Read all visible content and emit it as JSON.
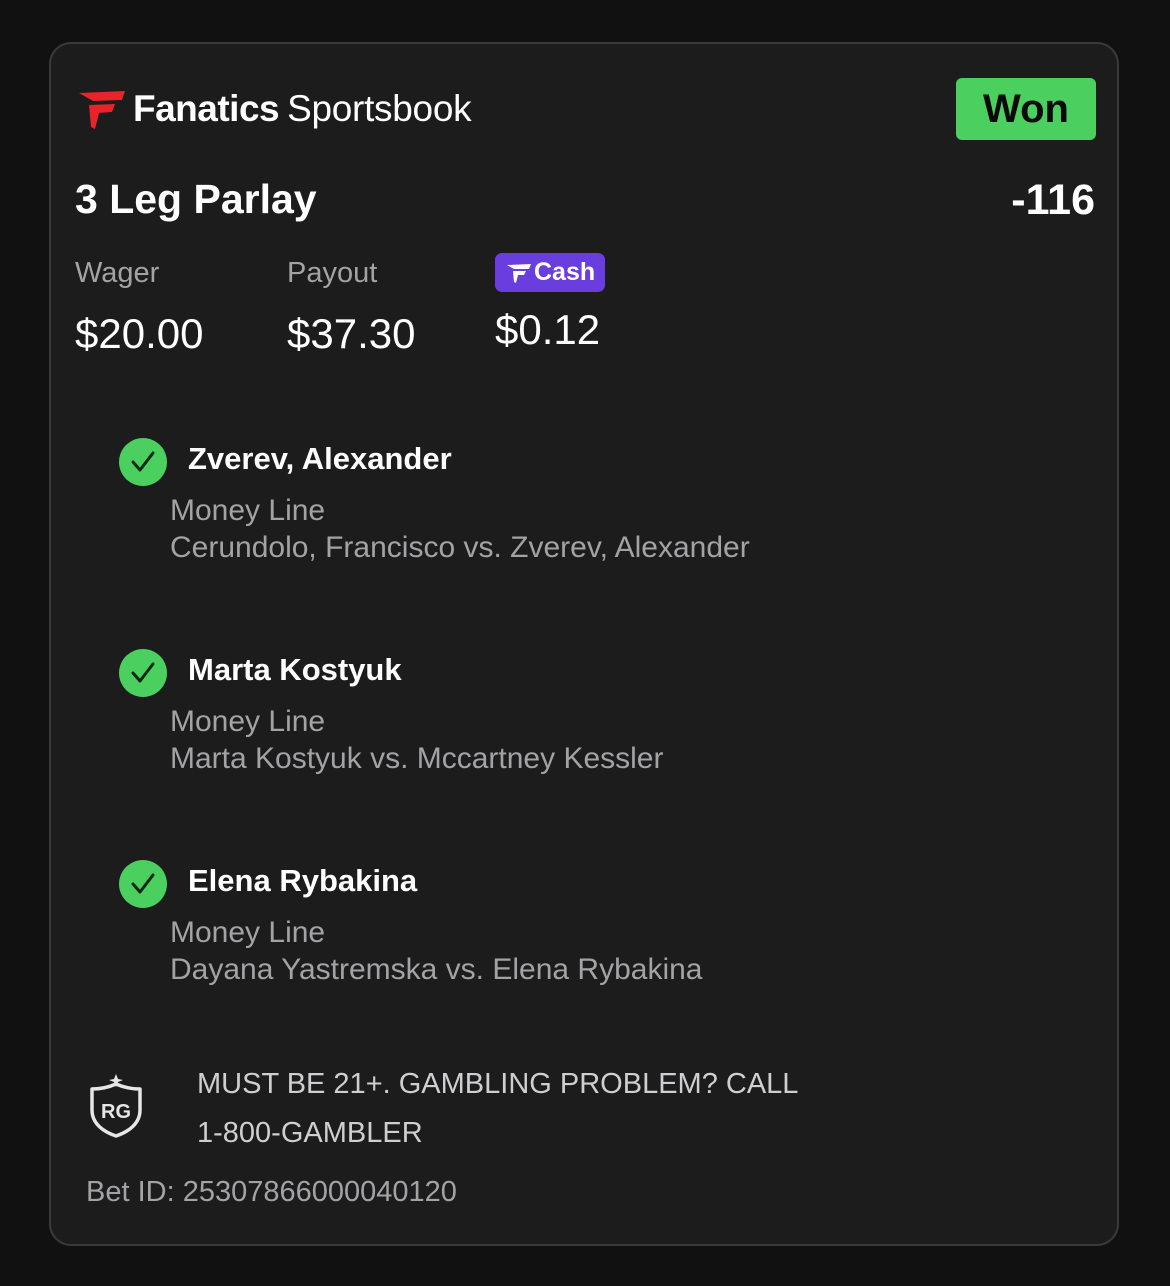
{
  "brand": {
    "name_bold": "Fanatics",
    "name_light": "Sportsbook"
  },
  "status": "Won",
  "bet": {
    "title": "3 Leg Parlay",
    "odds": "-116"
  },
  "stats": {
    "wager_label": "Wager",
    "wager_value": "$20.00",
    "payout_label": "Payout",
    "payout_value": "$37.30",
    "cash_label": "Cash",
    "cash_value": "$0.12"
  },
  "legs": [
    {
      "selection": "Zverev, Alexander",
      "market": "Money Line",
      "event": "Cerundolo, Francisco vs. Zverev, Alexander"
    },
    {
      "selection": "Marta Kostyuk",
      "market": "Money Line",
      "event": "Marta Kostyuk vs. Mccartney Kessler"
    },
    {
      "selection": "Elena Rybakina",
      "market": "Money Line",
      "event": "Dayana Yastremska vs. Elena Rybakina"
    }
  ],
  "responsible_gaming": {
    "icon_text": "RG",
    "line1": "MUST BE 21+. GAMBLING PROBLEM? CALL",
    "line2": "1-800-GAMBLER"
  },
  "bet_id": "Bet ID: 253078660000401​20",
  "colors": {
    "background": "#111111",
    "card": "#1c1c1d",
    "won_green": "#4bd05f",
    "cash_purple": "#6a3ddf",
    "brand_red": "#e8232a"
  },
  "icons": [
    "fanatics-logo-icon",
    "fcash-logo-icon",
    "checkmark-icon",
    "rg-shield-icon"
  ]
}
